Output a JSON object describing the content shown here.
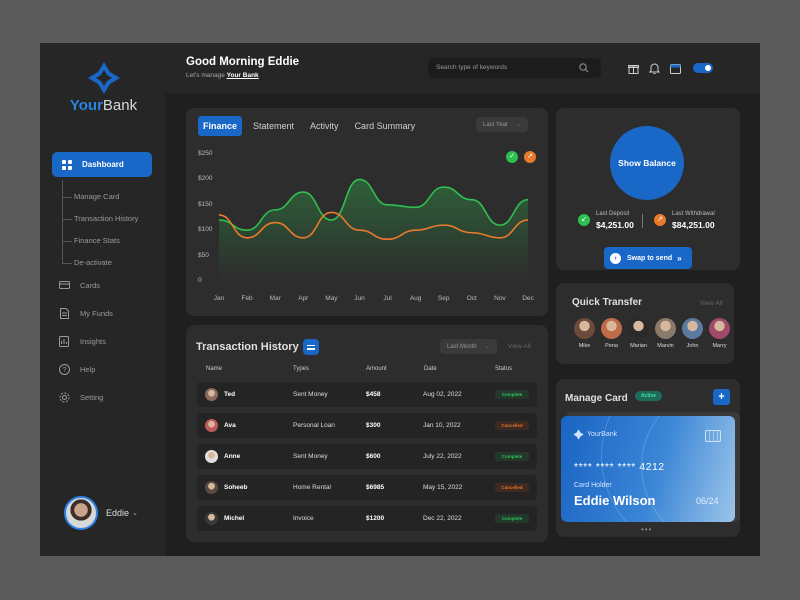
{
  "brand": {
    "name_part1": "Your",
    "name_part2": "Bank",
    "accent": "#1967c6"
  },
  "sidebar": {
    "active_item": "Dashboard",
    "subitems": [
      "Manage Card",
      "Transaction History",
      "Finance Stats",
      "De-activate"
    ],
    "items": [
      {
        "label": "Cards",
        "icon": "card-icon"
      },
      {
        "label": "My Funds",
        "icon": "document-icon"
      },
      {
        "label": "Insights",
        "icon": "insights-icon"
      },
      {
        "label": "Help",
        "icon": "help-icon"
      },
      {
        "label": "Setting",
        "icon": "gear-icon"
      }
    ],
    "profile_name": "Eddie"
  },
  "header": {
    "greeting": "Good Morning Eddie",
    "subtitle_prefix": "Let's manage ",
    "subtitle_link": "Your Bank",
    "search_placeholder": "Search type of keywords"
  },
  "finance": {
    "tabs": [
      "Finance",
      "Statement",
      "Activity",
      "Card Summary"
    ],
    "active_tab": "Finance",
    "period": "Last Year"
  },
  "chart_data": {
    "type": "line",
    "categories": [
      "Jan",
      "Feb",
      "Mar",
      "Apr",
      "May",
      "Jun",
      "Jul",
      "Aug",
      "Sep",
      "Oct",
      "Nov",
      "Dec"
    ],
    "y_ticks": [
      "$250",
      "$200",
      "$150",
      "$100",
      "$50",
      "0"
    ],
    "ylim": [
      0,
      250
    ],
    "series": [
      {
        "color": "#2fbf4f",
        "values": [
          120,
          100,
          140,
          175,
          120,
          200,
          150,
          145,
          185,
          160,
          110,
          160
        ],
        "symbol": "✓"
      },
      {
        "color": "#e97a2b",
        "values": [
          130,
          85,
          115,
          85,
          135,
          100,
          82,
          100,
          110,
          95,
          85,
          120
        ],
        "symbol": "↗"
      }
    ]
  },
  "balance": {
    "button": "Show Balance",
    "last_deposit_label": "Last Deposit",
    "last_deposit_value": "$4,251.00",
    "last_withdrawal_label": "Last Withdrawal",
    "last_withdrawal_value": "$84,251.00",
    "swap_label": "Swap to send"
  },
  "quick_transfer": {
    "title": "Quick Transfer",
    "view_all": "View All",
    "contacts": [
      {
        "name": "Mike",
        "color": "#6a4a3a"
      },
      {
        "name": "Pena",
        "color": "#c06a4a"
      },
      {
        "name": "Marian",
        "color": "#2a2a2a"
      },
      {
        "name": "Marvin",
        "color": "#8a7a6a"
      },
      {
        "name": "John",
        "color": "#5a7aa0"
      },
      {
        "name": "Marry",
        "color": "#a04a6a"
      }
    ]
  },
  "transactions": {
    "title": "Transaction History",
    "filter": "Last Month",
    "view_all": "View All",
    "columns": [
      "Name",
      "Types",
      "Amount",
      "Date",
      "Status"
    ],
    "rows": [
      {
        "name": "Ted",
        "type": "Sent Money",
        "amount": "$458",
        "date": "Aug 02, 2022",
        "status": "Complete",
        "status_kind": "complete",
        "avatar_color": "#8a6a5a"
      },
      {
        "name": "Ava",
        "type": "Personal Loan",
        "amount": "$300",
        "date": "Jan 10, 2022",
        "status": "Cancelled",
        "status_kind": "cancelled",
        "avatar_color": "#c05a5a"
      },
      {
        "name": "Anne",
        "type": "Sent Money",
        "amount": "$600",
        "date": "July 22, 2022",
        "status": "Complete",
        "status_kind": "complete",
        "avatar_color": "#e0e0e0"
      },
      {
        "name": "Soheeb",
        "type": "Home Rental",
        "amount": "$6985",
        "date": "May 15, 2022",
        "status": "Cancelled",
        "status_kind": "cancelled",
        "avatar_color": "#5a4a42"
      },
      {
        "name": "Michel",
        "type": "Invoice",
        "amount": "$1200",
        "date": "Dec 22, 2022",
        "status": "Complete",
        "status_kind": "complete",
        "avatar_color": "#3a3a3a"
      }
    ]
  },
  "manage_card": {
    "title": "Manage Card",
    "badge": "Active",
    "add_label": "+",
    "card_brand": "YourBank",
    "card_number": "**** **** **** 4212",
    "holder_label": "Card Holder",
    "holder_name": "Eddie Wilson",
    "expiry": "06/24"
  }
}
